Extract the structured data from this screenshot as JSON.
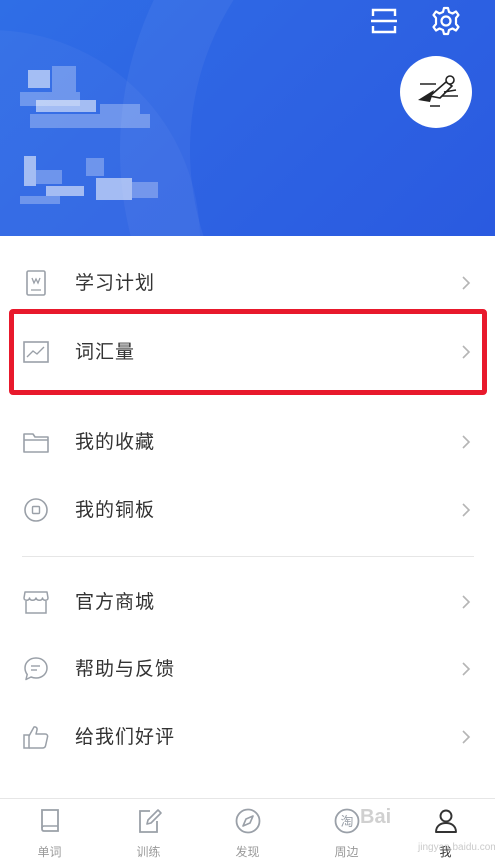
{
  "menu": {
    "group1": [
      {
        "id": "study-plan",
        "label": "学习计划",
        "icon": "book-icon"
      },
      {
        "id": "vocabulary",
        "label": "词汇量",
        "icon": "chart-icon"
      },
      {
        "id": "favorites",
        "label": "我的收藏",
        "icon": "folder-icon"
      },
      {
        "id": "copper",
        "label": "我的铜板",
        "icon": "coin-icon"
      }
    ],
    "group2": [
      {
        "id": "store",
        "label": "官方商城",
        "icon": "store-icon"
      },
      {
        "id": "feedback",
        "label": "帮助与反馈",
        "icon": "chat-icon"
      },
      {
        "id": "rate",
        "label": "给我们好评",
        "icon": "thumbs-up-icon"
      }
    ]
  },
  "nav": {
    "items": [
      {
        "label": "单词",
        "icon": "book-icon"
      },
      {
        "label": "训练",
        "icon": "edit-icon"
      },
      {
        "label": "发现",
        "icon": "compass-icon"
      },
      {
        "label": "周边",
        "icon": "shop-icon"
      },
      {
        "label": "我",
        "icon": "person-icon"
      }
    ],
    "active_index": 4
  },
  "watermark": {
    "text": "Bai",
    "sub": "jingyan.baidu.com"
  },
  "colors": {
    "header": "#2e64e3",
    "highlight": "#e8192c",
    "icon": "#9aa0a8"
  }
}
